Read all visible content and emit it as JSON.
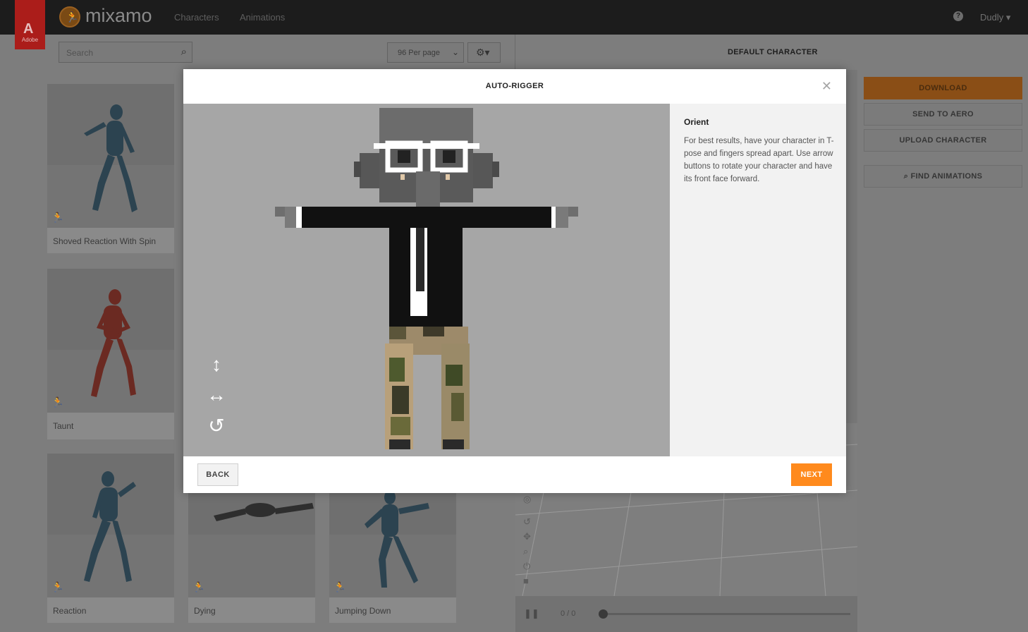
{
  "header": {
    "adobe_label": "Adobe",
    "app_name": "mixamo",
    "nav": [
      "Characters",
      "Animations"
    ],
    "user": "Dudly"
  },
  "toolbar": {
    "search_placeholder": "Search",
    "per_page": "96 Per page",
    "default_character": "DEFAULT CHARACTER"
  },
  "grid": {
    "cards": [
      {
        "label": "Shoved Reaction With Spin"
      },
      {
        "label": "Taunt"
      },
      {
        "label": "Reaction"
      },
      {
        "label": "Dying"
      },
      {
        "label": "Jumping Down"
      }
    ]
  },
  "right_panel": {
    "download": "DOWNLOAD",
    "send_to_aero": "SEND TO AERO",
    "upload_character": "UPLOAD CHARACTER",
    "find_animations": "FIND ANIMATIONS"
  },
  "timeline": {
    "frame_count": "0 / 0"
  },
  "modal": {
    "title": "AUTO-RIGGER",
    "step_title": "Orient",
    "step_body": "For best results, have your character in T-pose and fingers spread apart. Use arrow buttons to rotate your character and have its front face forward.",
    "back": "BACK",
    "next": "NEXT"
  },
  "colors": {
    "accent": "#ff8a1d",
    "topbar": "#1c1c1c",
    "adobe_red": "#ab1d1a"
  },
  "icons": {
    "move_vertical": "up-down-arrow-icon",
    "move_horizontal": "left-right-arrow-icon",
    "rotate": "rotate-icon",
    "close": "close-icon"
  }
}
